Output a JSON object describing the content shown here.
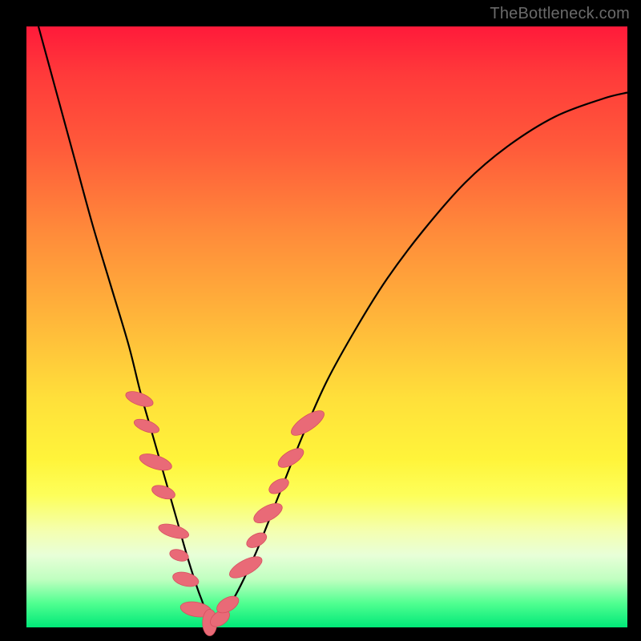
{
  "watermark": "TheBottleneck.com",
  "colors": {
    "curve_stroke": "#000000",
    "bead_fill": "#e96a77",
    "bead_stroke": "#d6505f"
  },
  "chart_data": {
    "type": "line",
    "title": "",
    "xlabel": "",
    "ylabel": "",
    "xlim": [
      0,
      100
    ],
    "ylim": [
      0,
      100
    ],
    "series": [
      {
        "name": "bottleneck-curve",
        "x": [
          2,
          5,
          8,
          11,
          14,
          17,
          19,
          21,
          23,
          25,
          27,
          29,
          31,
          34,
          38,
          42,
          46,
          50,
          55,
          60,
          66,
          73,
          80,
          88,
          96,
          100
        ],
        "y": [
          100,
          89,
          78,
          67,
          57,
          47,
          39,
          32,
          25,
          18,
          11,
          5,
          1,
          4,
          12,
          22,
          32,
          41,
          50,
          58,
          66,
          74,
          80,
          85,
          88,
          89
        ]
      }
    ],
    "beads": [
      {
        "x": 18.8,
        "y": 38.0,
        "rx": 1.0,
        "ry": 2.4,
        "rot": -70
      },
      {
        "x": 20.0,
        "y": 33.5,
        "rx": 0.9,
        "ry": 2.2,
        "rot": -70
      },
      {
        "x": 21.5,
        "y": 27.5,
        "rx": 1.1,
        "ry": 2.8,
        "rot": -72
      },
      {
        "x": 22.8,
        "y": 22.5,
        "rx": 1.0,
        "ry": 2.0,
        "rot": -72
      },
      {
        "x": 24.5,
        "y": 16.0,
        "rx": 1.0,
        "ry": 2.6,
        "rot": -74
      },
      {
        "x": 25.4,
        "y": 12.0,
        "rx": 0.9,
        "ry": 1.6,
        "rot": -74
      },
      {
        "x": 26.5,
        "y": 8.0,
        "rx": 1.1,
        "ry": 2.2,
        "rot": -76
      },
      {
        "x": 28.2,
        "y": 3.0,
        "rx": 1.2,
        "ry": 2.6,
        "rot": -80
      },
      {
        "x": 30.5,
        "y": 0.8,
        "rx": 1.2,
        "ry": 2.2,
        "rot": 0
      },
      {
        "x": 32.2,
        "y": 1.5,
        "rx": 1.1,
        "ry": 1.8,
        "rot": 55
      },
      {
        "x": 33.5,
        "y": 3.8,
        "rx": 1.1,
        "ry": 2.0,
        "rot": 60
      },
      {
        "x": 36.5,
        "y": 10.0,
        "rx": 1.2,
        "ry": 3.0,
        "rot": 62
      },
      {
        "x": 38.3,
        "y": 14.5,
        "rx": 1.0,
        "ry": 1.8,
        "rot": 62
      },
      {
        "x": 40.2,
        "y": 19.0,
        "rx": 1.2,
        "ry": 2.6,
        "rot": 62
      },
      {
        "x": 42.0,
        "y": 23.5,
        "rx": 1.0,
        "ry": 1.8,
        "rot": 60
      },
      {
        "x": 44.0,
        "y": 28.2,
        "rx": 1.1,
        "ry": 2.4,
        "rot": 58
      },
      {
        "x": 46.8,
        "y": 34.0,
        "rx": 1.2,
        "ry": 3.2,
        "rot": 56
      }
    ]
  }
}
